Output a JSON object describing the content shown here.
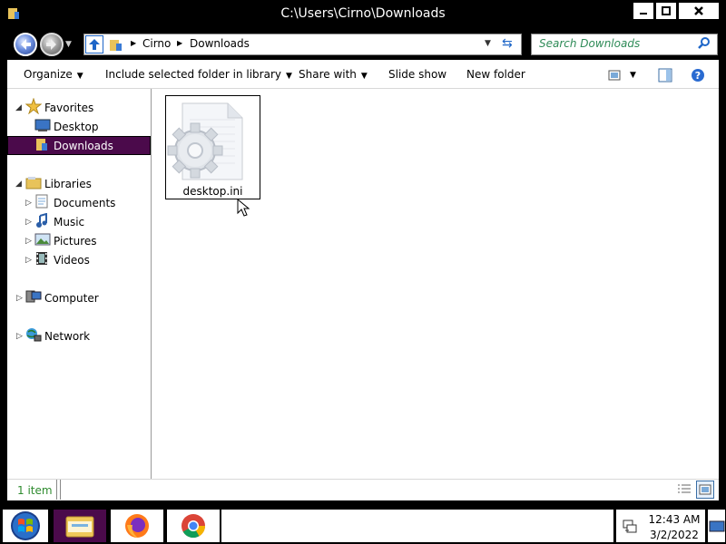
{
  "window": {
    "title": "C:\\Users\\Cirno\\Downloads"
  },
  "address": {
    "crumbs": [
      "Cirno",
      "Downloads"
    ]
  },
  "search": {
    "placeholder": "Search Downloads"
  },
  "toolbar": {
    "organize": "Organize",
    "include_library": "Include selected folder in library",
    "share_with": "Share with",
    "slide_show": "Slide show",
    "new_folder": "New folder"
  },
  "nav": {
    "favorites": {
      "label": "Favorites",
      "items": [
        "Desktop",
        "Downloads"
      ]
    },
    "libraries": {
      "label": "Libraries",
      "items": [
        "Documents",
        "Music",
        "Pictures",
        "Videos"
      ]
    },
    "computer": "Computer",
    "network": "Network"
  },
  "files": [
    {
      "name": "desktop.ini",
      "icon": "settings-file-icon"
    }
  ],
  "status": {
    "count": "1 item"
  },
  "taskbar": {
    "time": "12:43 AM",
    "date": "3/2/2022"
  },
  "colors": {
    "selection": "#4b0a4b",
    "accent": "#1e66c8",
    "status_text": "#2e8b2e"
  }
}
